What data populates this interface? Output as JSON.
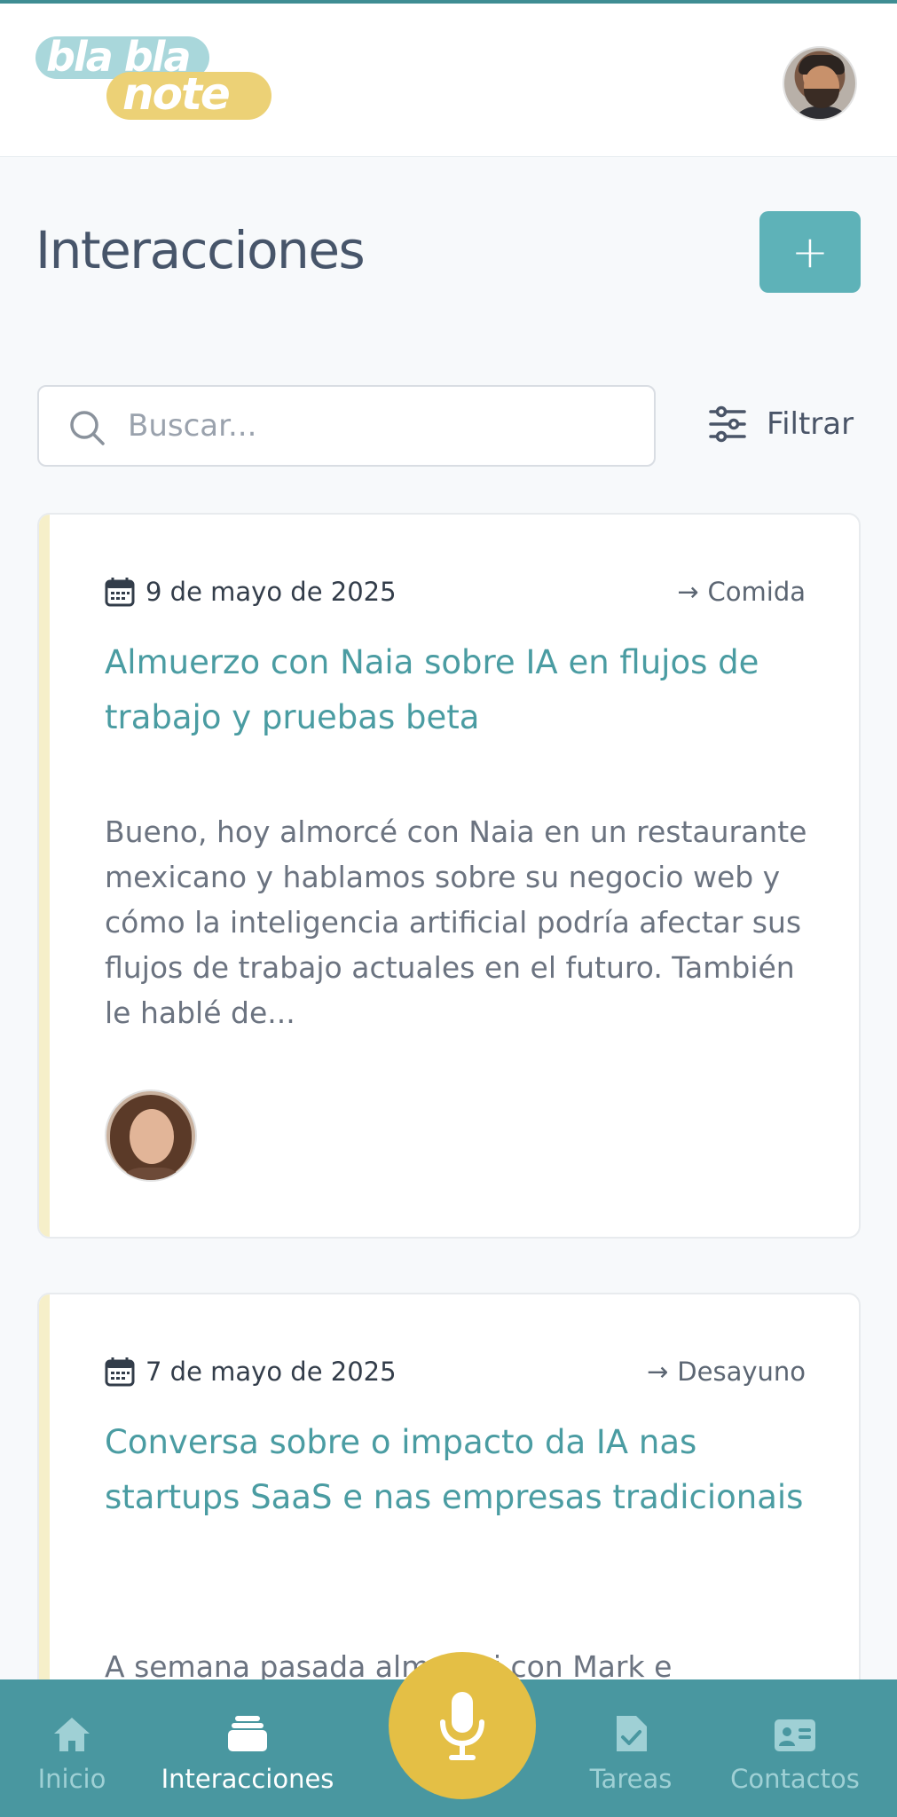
{
  "app": {
    "logo_line1": "bla bla",
    "logo_line2": "note",
    "accent_color": "#5eb2b8",
    "mic_color": "#e4bf45"
  },
  "header": {
    "user_avatar": "user-avatar"
  },
  "page": {
    "title": "Interacciones",
    "add_label": "+"
  },
  "search": {
    "placeholder": "Buscar...",
    "value": ""
  },
  "filter": {
    "label": "Filtrar"
  },
  "interactions": [
    {
      "date": "9 de mayo de 2025",
      "category": "Comida",
      "title": "Almuerzo con Naia sobre IA en flujos de trabajo y pruebas beta",
      "body": "Bueno, hoy almorcé con Naia en un restaurante mexicano y hablamos sobre su negocio web y cómo la inteligencia artificial podría afectar sus flujos de trabajo actuales en el futuro. También le hablé de..."
    },
    {
      "date": "7 de mayo de 2025",
      "category": "Desayuno",
      "title": "Conversa sobre o impacto da IA nas startups SaaS e nas empresas tradicionais",
      "body": "A semana pasada almorcei con Mark e"
    }
  ],
  "nav": {
    "items": [
      {
        "label": "Inicio",
        "icon": "home-icon"
      },
      {
        "label": "Interacciones",
        "icon": "stack-icon"
      },
      {
        "label": "Tareas",
        "icon": "task-icon"
      },
      {
        "label": "Contactos",
        "icon": "contact-card-icon"
      }
    ],
    "active": "Interacciones"
  }
}
